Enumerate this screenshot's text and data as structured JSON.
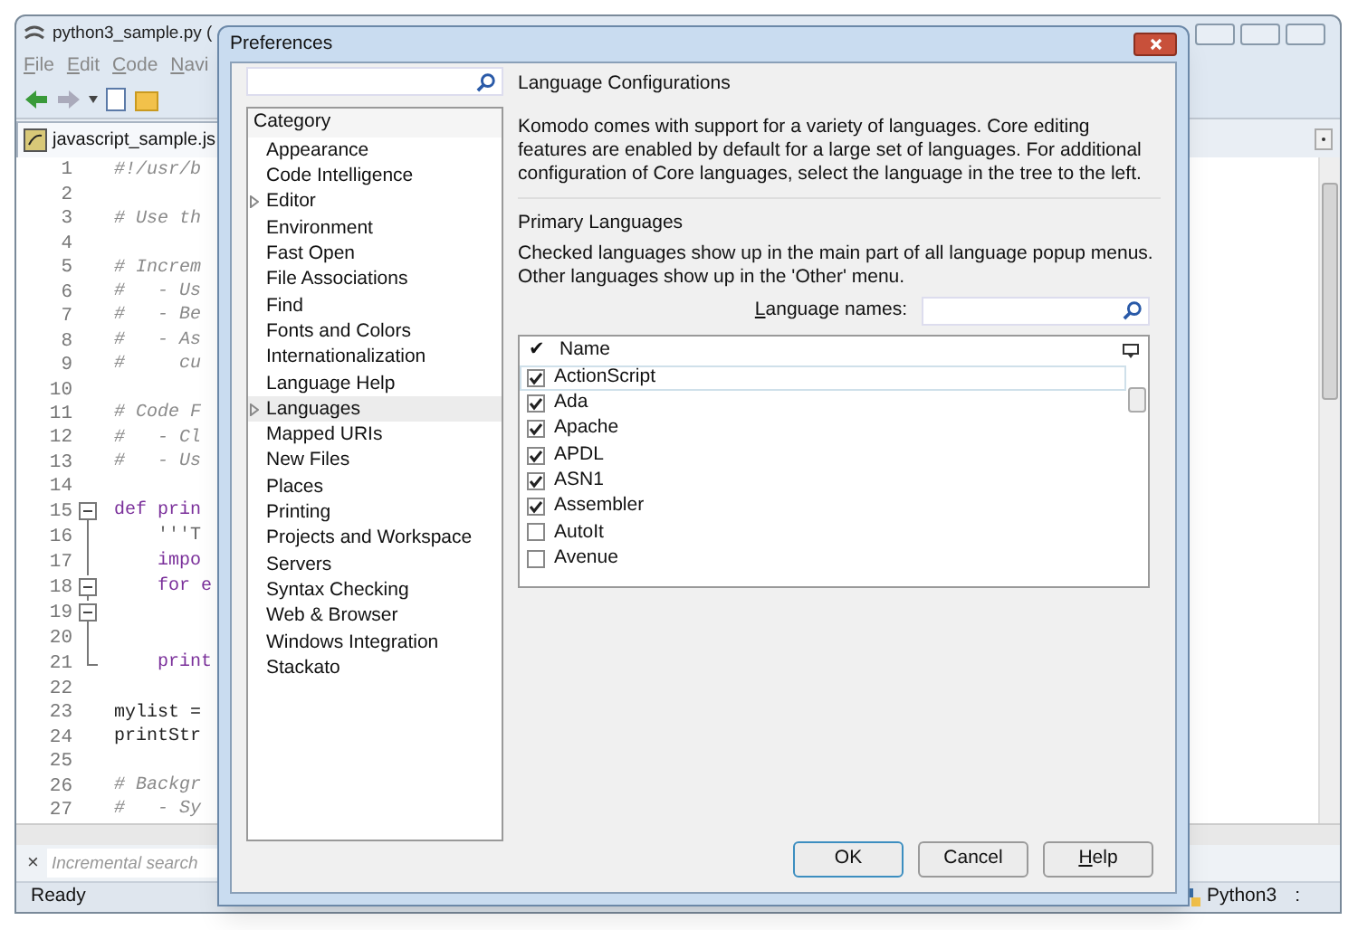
{
  "editor": {
    "title": "python3_sample.py (",
    "menu": [
      {
        "label": "File",
        "accel": true
      },
      {
        "label": "Edit",
        "accel": true
      },
      {
        "label": "Code",
        "accel": true
      },
      {
        "label": "Navi",
        "accel": true
      }
    ],
    "tab": "javascript_sample.js",
    "lines": [
      {
        "no": "1",
        "text": "#!/usr/b",
        "kind": "comment"
      },
      {
        "no": "2"
      },
      {
        "no": "3",
        "text": "# Use th",
        "kind": "comment"
      },
      {
        "no": "4"
      },
      {
        "no": "5",
        "text": "# Increm",
        "kind": "comment"
      },
      {
        "no": "6",
        "text": "#   - Us",
        "kind": "comment"
      },
      {
        "no": "7",
        "text": "#   - Be",
        "kind": "comment"
      },
      {
        "no": "8",
        "text": "#   - As",
        "kind": "comment"
      },
      {
        "no": "9",
        "text": "#     cu",
        "kind": "comment"
      },
      {
        "no": "10"
      },
      {
        "no": "11",
        "text": "# Code F",
        "kind": "comment"
      },
      {
        "no": "12",
        "text": "#   - Cl",
        "kind": "comment"
      },
      {
        "no": "13",
        "text": "#   - Us",
        "kind": "comment"
      },
      {
        "no": "14"
      },
      {
        "no": "15",
        "text": "def prin",
        "kind": "keyword",
        "fold_start": true
      },
      {
        "no": "16",
        "text": "    '''T",
        "kind": "string",
        "fold_line": true
      },
      {
        "no": "17",
        "text": "    impo",
        "kind": "keyword",
        "fold_line": true
      },
      {
        "no": "18",
        "text": "    for e",
        "kind": "keyword",
        "fold_start": true
      },
      {
        "no": "19",
        "fold_start": true
      },
      {
        "no": "20",
        "fold_line": true
      },
      {
        "no": "21",
        "text": "    print",
        "kind": "keyword",
        "fold_end": true
      },
      {
        "no": "22"
      },
      {
        "no": "23",
        "text": "mylist =",
        "kind": "code"
      },
      {
        "no": "24",
        "text": "printStr",
        "kind": "code"
      },
      {
        "no": "25"
      },
      {
        "no": "26",
        "text": "# Backgr",
        "kind": "comment"
      },
      {
        "no": "27",
        "text": "#   - Sy",
        "kind": "comment"
      }
    ],
    "search_close": "×",
    "search": {
      "placeholder": "Incremental search"
    },
    "status": "Ready",
    "language": "Python3",
    "language_spin": ":"
  },
  "dialog": {
    "title": "Preferences",
    "category_header": "Category",
    "categories": [
      {
        "label": "Appearance",
        "expandable": false,
        "selected": false
      },
      {
        "label": "Code Intelligence",
        "expandable": false,
        "selected": false
      },
      {
        "label": "Editor",
        "expandable": true,
        "selected": false
      },
      {
        "label": "Environment",
        "expandable": false,
        "selected": false
      },
      {
        "label": "Fast Open",
        "expandable": false,
        "selected": false
      },
      {
        "label": "File Associations",
        "expandable": false,
        "selected": false
      },
      {
        "label": "Find",
        "expandable": false,
        "selected": false
      },
      {
        "label": "Fonts and Colors",
        "expandable": false,
        "selected": false
      },
      {
        "label": "Internationalization",
        "expandable": false,
        "selected": false
      },
      {
        "label": "Language Help",
        "expandable": false,
        "selected": false
      },
      {
        "label": "Languages",
        "expandable": true,
        "selected": true
      },
      {
        "label": "Mapped URIs",
        "expandable": false,
        "selected": false
      },
      {
        "label": "New Files",
        "expandable": false,
        "selected": false
      },
      {
        "label": "Places",
        "expandable": false,
        "selected": false
      },
      {
        "label": "Printing",
        "expandable": false,
        "selected": false
      },
      {
        "label": "Projects and Workspace",
        "expandable": false,
        "selected": false
      },
      {
        "label": "Servers",
        "expandable": false,
        "selected": false
      },
      {
        "label": "Syntax Checking",
        "expandable": false,
        "selected": false
      },
      {
        "label": "Web & Browser",
        "expandable": false,
        "selected": false
      },
      {
        "label": "Windows Integration",
        "expandable": false,
        "selected": false
      },
      {
        "label": "Stackato",
        "expandable": false,
        "selected": false
      }
    ],
    "config_title": "Language Configurations",
    "config_text": "Komodo comes with support for a variety of languages. Core editing features are enabled by default for a large set of languages. For additional configuration of Core languages, select the language in the tree to the left.",
    "primary_title": "Primary Languages",
    "primary_text": "Checked languages show up in the main part of all language popup menus. Other languages show up in the 'Other' menu.",
    "names_label": {
      "label": "Language names:",
      "accel": true
    },
    "list_header": {
      "check": "✔",
      "name": "Name"
    },
    "languages": [
      {
        "name": "ActionScript",
        "checked": true,
        "selected": true
      },
      {
        "name": "Ada",
        "checked": true,
        "selected": false
      },
      {
        "name": "Apache",
        "checked": true,
        "selected": false
      },
      {
        "name": "APDL",
        "checked": true,
        "selected": false
      },
      {
        "name": "ASN1",
        "checked": true,
        "selected": false
      },
      {
        "name": "Assembler",
        "checked": true,
        "selected": false
      },
      {
        "name": "AutoIt",
        "checked": false,
        "selected": false
      },
      {
        "name": "Avenue",
        "checked": false,
        "selected": false
      }
    ],
    "buttons": [
      {
        "label": "OK",
        "accel": false,
        "default": true
      },
      {
        "label": "Cancel",
        "accel": false,
        "default": false
      },
      {
        "label": "Help",
        "accel": true,
        "default": false
      }
    ]
  }
}
